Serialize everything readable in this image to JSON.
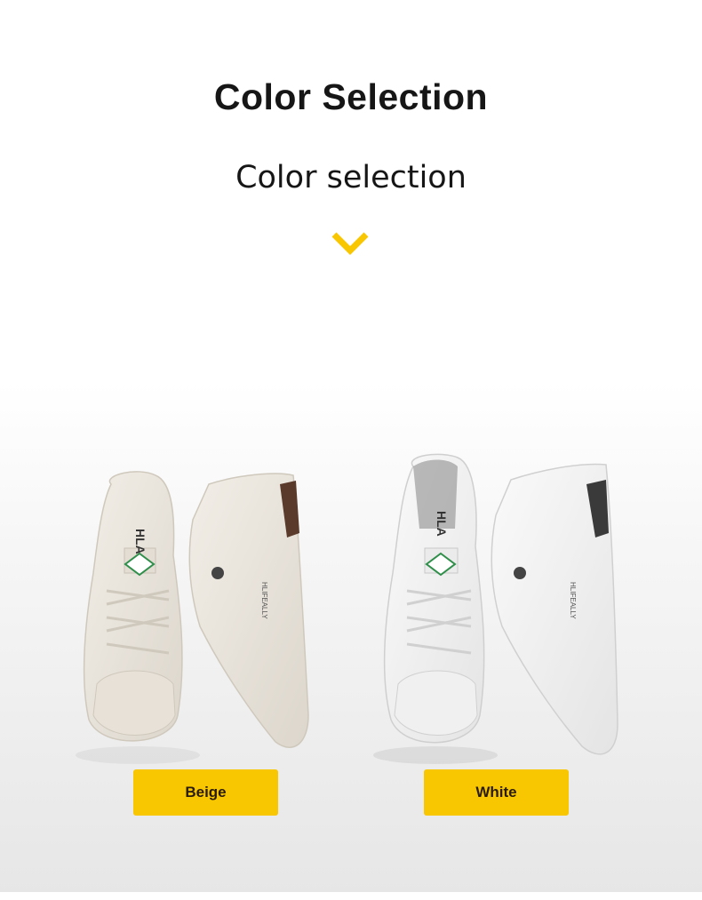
{
  "header": {
    "title": "Color Selection",
    "subtitle": "Color selection",
    "indicator_icon": "chevron-down-icon",
    "accent_color": "#f9c701"
  },
  "products": [
    {
      "color_label": "Beige",
      "shoe_color": "#ebe6de",
      "sole_color": "#f1eee8",
      "shoe_icon": "sneaker-icon",
      "tongue_text": "HLA",
      "side_text": "HLIFEALLY"
    },
    {
      "color_label": "White",
      "shoe_color": "#f3f3f3",
      "sole_color": "#ffffff",
      "shoe_icon": "sneaker-icon",
      "tongue_text": "HLA",
      "side_text": "HLIFEALLY"
    }
  ]
}
